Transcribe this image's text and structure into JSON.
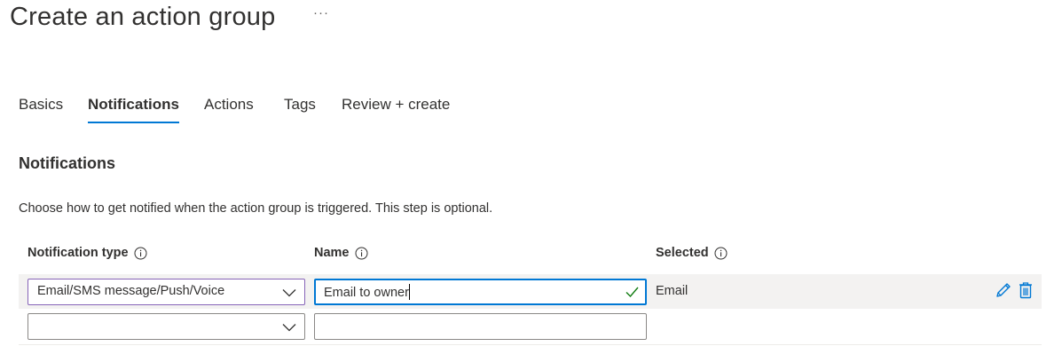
{
  "page": {
    "title": "Create an action group",
    "more_label": "···"
  },
  "tabs": [
    {
      "label": "Basics",
      "active": false
    },
    {
      "label": "Notifications",
      "active": true
    },
    {
      "label": "Actions",
      "active": false
    },
    {
      "label": "Tags",
      "active": false
    },
    {
      "label": "Review + create",
      "active": false
    }
  ],
  "section": {
    "title": "Notifications",
    "description": "Choose how to get notified when the action group is triggered. This step is optional."
  },
  "table": {
    "headers": {
      "notification_type": "Notification type",
      "name": "Name",
      "selected": "Selected"
    },
    "rows": [
      {
        "notification_type": "Email/SMS message/Push/Voice",
        "name": "Email to owner",
        "selected": "Email",
        "name_valid": true
      },
      {
        "notification_type": "",
        "name": "",
        "selected": ""
      }
    ]
  },
  "colors": {
    "accent": "#0078d4",
    "focus_purple": "#8764b8",
    "valid_green": "#107c10",
    "row_highlight": "#f3f2f1"
  },
  "icons": [
    "more-icon",
    "info-icon",
    "chevron-down-icon",
    "checkmark-icon",
    "edit-icon",
    "delete-icon"
  ]
}
